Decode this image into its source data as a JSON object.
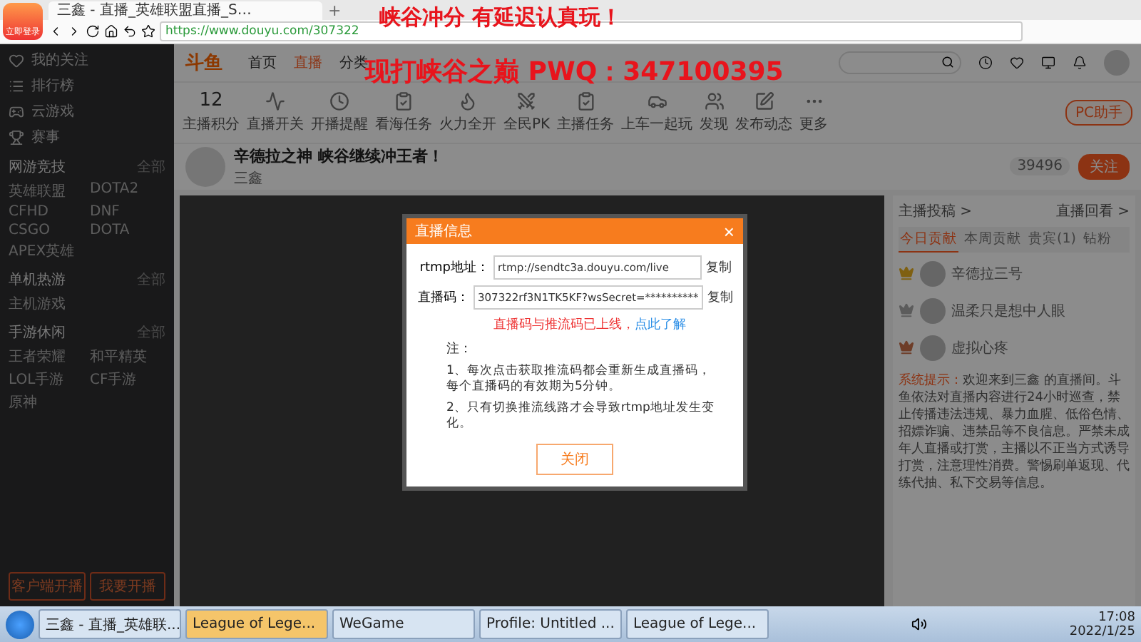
{
  "browser": {
    "badge": "立即登录",
    "tab_title": "三鑫 - 直播_英雄联盟直播_S…",
    "new_tab": "+",
    "url": "https://www.douyu.com/307322"
  },
  "stream_overlay": [
    "峡谷冲分 有延迟认真玩！",
    "现打峡谷之巅 PWQ：347100395"
  ],
  "sidebar": {
    "items": [
      {
        "label": "我的关注"
      },
      {
        "label": "排行榜"
      },
      {
        "label": "云游戏"
      },
      {
        "label": "赛事"
      }
    ],
    "sections": [
      {
        "title": "网游竞技",
        "more": "全部",
        "games": [
          "英雄联盟",
          "DOTA2",
          "CFHD",
          "DNF",
          "CSGO",
          "DOTA",
          "APEX英雄"
        ]
      },
      {
        "title": "单机热游",
        "more": "全部",
        "games": [
          "主机游戏"
        ]
      },
      {
        "title": "手游休闲",
        "more": "全部",
        "games": [
          "王者荣耀",
          "和平精英",
          "LOL手游",
          "CF手游",
          "原神"
        ]
      }
    ],
    "buttons": [
      "客户端开播",
      "我要开播"
    ]
  },
  "nav": {
    "logo": "斗鱼",
    "links": [
      {
        "label": "首页",
        "selected": false
      },
      {
        "label": "直播",
        "selected": true
      },
      {
        "label": "分类",
        "selected": false
      }
    ]
  },
  "toolbar": {
    "points": "12",
    "points_label": "主播积分",
    "items": [
      "直播开关",
      "开播提醒",
      "看海任务",
      "火力全开",
      "全民PK",
      "主播任务",
      "上车一起玩",
      "发现",
      "发布动态",
      "更多"
    ],
    "pc_button": "PC助手"
  },
  "room": {
    "title": "辛德拉之神 峡谷继续冲王者！",
    "host": "三鑫",
    "hot": "39496",
    "follow": "关注"
  },
  "dialog": {
    "title": "直播信息",
    "close_icon": "×",
    "rows": [
      {
        "label": "rtmp地址：",
        "value": "rtmp://sendtc3a.douyu.com/live",
        "copy": "复制"
      },
      {
        "label": "直播码：",
        "value": "307322rf3N1TK5KF?wsSecret=**********",
        "copy": "复制"
      }
    ],
    "warning": "直播码与推流码已上线，",
    "link": "点此了解",
    "notes_title": "注：",
    "notes": [
      "1、每次点击获取推流码都会重新生成直播码，每个直播码的有效期为5分钟。",
      "2、只有切换推流线路才会导致rtmp地址发生变化。"
    ],
    "close": "关闭"
  },
  "right": {
    "links": [
      "主播投稿 >",
      "直播回看 >"
    ],
    "tabs": [
      {
        "label": "今日贡献",
        "selected": true
      },
      {
        "label": "本周贡献",
        "selected": false
      },
      {
        "label": "贵宾(1)",
        "selected": false
      },
      {
        "label": "钻粉",
        "selected": false
      }
    ],
    "rank": [
      {
        "name": "辛德拉三号"
      },
      {
        "name": "温柔只是想中人眼"
      },
      {
        "name": "虚拟心疼"
      }
    ],
    "notice_label": "系统提示：",
    "notice": "欢迎来到三鑫 的直播间。斗鱼依法对直播内容进行24小时巡查，禁止传播违法违规、暴力血腥、低俗色情、招嫖诈骗、违禁品等不良信息。严禁未成年人直播或打赏，主播以不正当方式诱导打赏，注意理性消费。警惕刷单返现、代练代抽、私下交易等信息。"
  },
  "taskbar": {
    "apps": [
      {
        "label": "三鑫 - 直播_英雄联...",
        "selected": false
      },
      {
        "label": "League of Lege...",
        "selected": true
      },
      {
        "label": "WeGame",
        "selected": false
      },
      {
        "label": "Profile: Untitled ...",
        "selected": false
      },
      {
        "label": "League of Lege...",
        "selected": false
      }
    ],
    "time": "17:08",
    "date": "2022/1/25"
  }
}
